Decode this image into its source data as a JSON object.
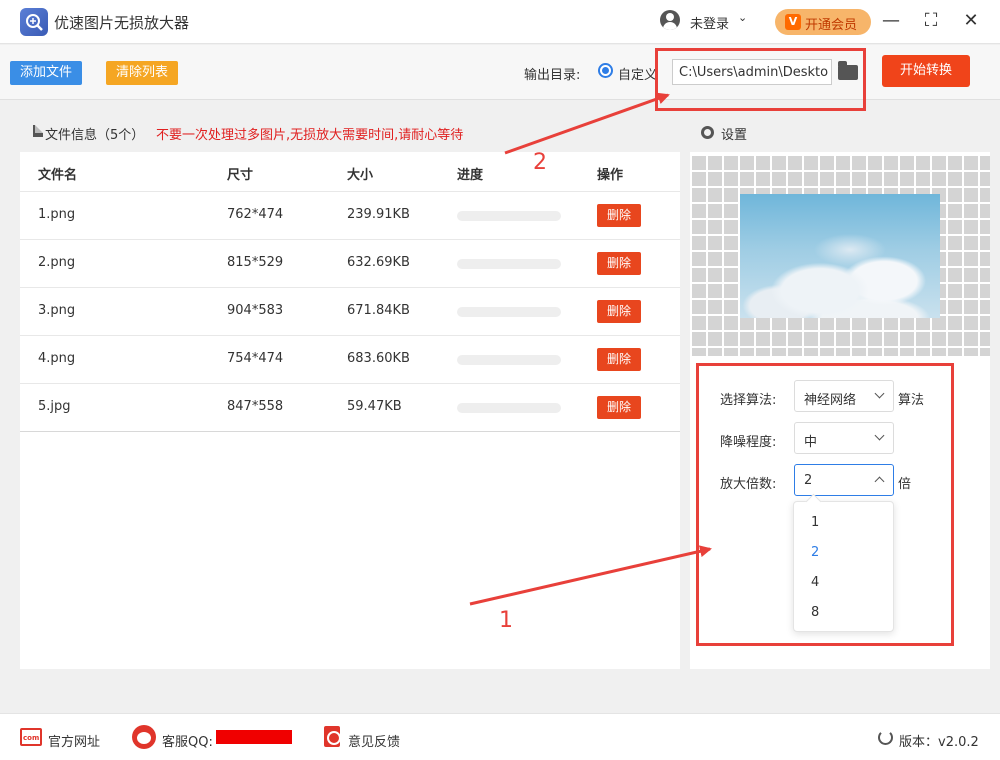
{
  "titlebar": {
    "app_title": "优速图片无损放大器",
    "login_label": "未登录",
    "login_caret": "⌄",
    "vip_badge": "V",
    "vip_label": "开通会员",
    "min_glyph": "—",
    "max_glyph": "⛶",
    "close_glyph": "✕"
  },
  "toolbar": {
    "add_label": "添加文件",
    "clear_label": "清除列表",
    "output_label": "输出目录:",
    "radio_label": "自定义",
    "path_value": "C:\\Users\\admin\\Deskto",
    "start_label": "开始转换"
  },
  "file_panel": {
    "title": "文件信息（5个）",
    "warning": "不要一次处理过多图片,无损放大需要时间,请耐心等待",
    "headers": {
      "name": "文件名",
      "size": "尺寸",
      "bytes": "大小",
      "progress": "进度",
      "action": "操作"
    },
    "rows": [
      {
        "name": "1.png",
        "dims": "762*474",
        "size": "239.91KB",
        "progress": 0,
        "action": "删除"
      },
      {
        "name": "2.png",
        "dims": "815*529",
        "size": "632.69KB",
        "progress": 0,
        "action": "删除"
      },
      {
        "name": "3.png",
        "dims": "904*583",
        "size": "671.84KB",
        "progress": 0,
        "action": "删除"
      },
      {
        "name": "4.png",
        "dims": "754*474",
        "size": "683.60KB",
        "progress": 0,
        "action": "删除"
      },
      {
        "name": "5.jpg",
        "dims": "847*558",
        "size": "59.47KB",
        "progress": 0,
        "action": "删除"
      }
    ]
  },
  "settings": {
    "title": "设置",
    "algorithm_label": "选择算法:",
    "algorithm_value": "神经网络",
    "algorithm_suffix": "算法",
    "denoise_label": "降噪程度:",
    "denoise_value": "中",
    "scale_label": "放大倍数:",
    "scale_value": "2",
    "scale_suffix": "倍",
    "scale_options": [
      "1",
      "2",
      "4",
      "8"
    ],
    "scale_selected": "2"
  },
  "annotations": {
    "num_1": "1",
    "num_2": "2",
    "color": "#e8403a"
  },
  "footer": {
    "website": "官方网址",
    "qq": "客服QQ:",
    "feedback": "意见反馈",
    "version": "版本：v2.0.2"
  },
  "colors": {
    "primary": "#3a8ee6",
    "warning": "#f5a623",
    "danger": "#f0441a",
    "annotation": "#e8403a"
  }
}
